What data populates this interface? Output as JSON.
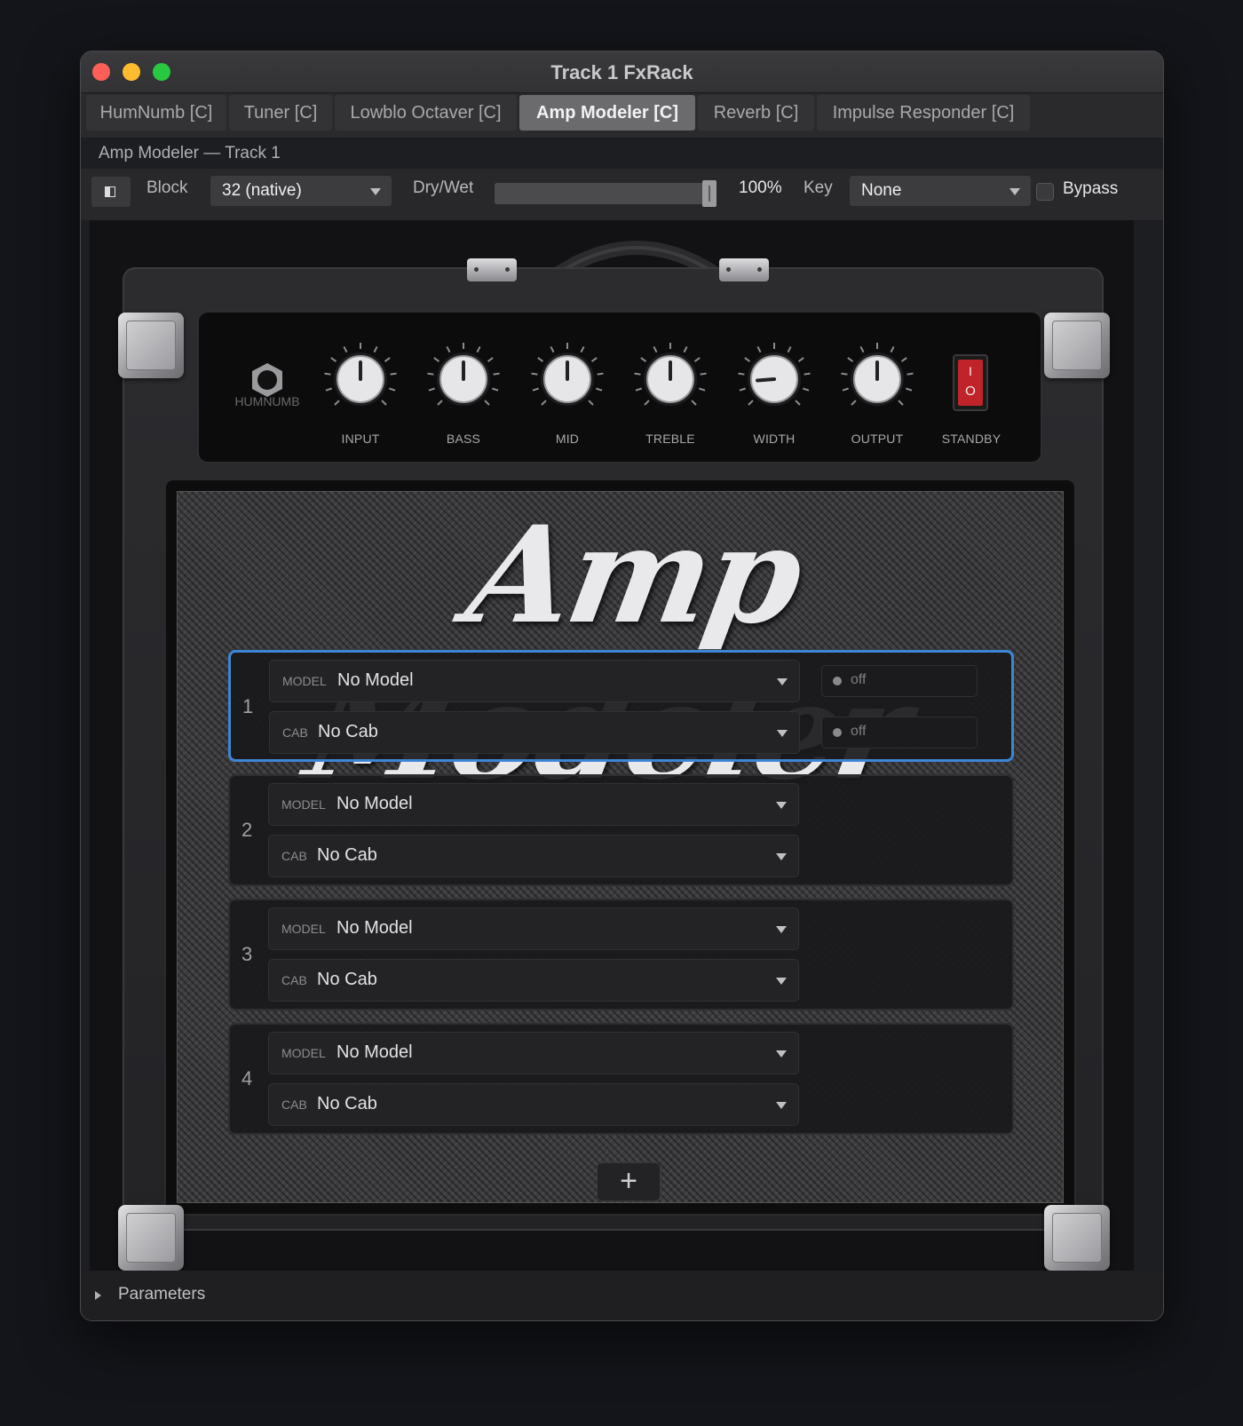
{
  "window": {
    "title": "Track 1 FxRack"
  },
  "tabs": [
    {
      "label": "HumNumb [C]",
      "active": false
    },
    {
      "label": "Tuner [C]",
      "active": false
    },
    {
      "label": "Lowblo Octaver [C]",
      "active": false
    },
    {
      "label": "Amp Modeler [C]",
      "active": true
    },
    {
      "label": "Reverb [C]",
      "active": false
    },
    {
      "label": "Impulse Responder [C]",
      "active": false
    }
  ],
  "subtitle": "Amp Modeler — Track 1",
  "toolbar": {
    "block_label": "Block",
    "block_value": "32 (native)",
    "drywet_label": "Dry/Wet",
    "drywet_value": "100%",
    "drywet_fraction": 0.98,
    "key_label": "Key",
    "key_value": "None",
    "bypass_label": "Bypass",
    "bypass_checked": false
  },
  "amp": {
    "logo": "Amp Modeler",
    "jack_label": "HUMNUMB",
    "knobs": [
      {
        "label": "INPUT",
        "level": 0.5
      },
      {
        "label": "BASS",
        "level": 0.5
      },
      {
        "label": "MID",
        "level": 0.5
      },
      {
        "label": "TREBLE",
        "level": 0.5
      },
      {
        "label": "WIDTH",
        "level": 0.15
      },
      {
        "label": "OUTPUT",
        "level": 0.5
      }
    ],
    "standby_label": "STANDBY",
    "standby_symbols": {
      "top": "I",
      "bottom": "O"
    },
    "slots": [
      {
        "number": "1",
        "model_kind": "MODEL",
        "model": "No Model",
        "cab_kind": "CAB",
        "cab": "No Cab",
        "model_toggle": "off",
        "cab_toggle": "off"
      },
      {
        "number": "2",
        "model_kind": "MODEL",
        "model": "No Model",
        "cab_kind": "CAB",
        "cab": "No Cab"
      },
      {
        "number": "3",
        "model_kind": "MODEL",
        "model": "No Model",
        "cab_kind": "CAB",
        "cab": "No Cab"
      },
      {
        "number": "4",
        "model_kind": "MODEL",
        "model": "No Model",
        "cab_kind": "CAB",
        "cab": "No Cab"
      }
    ],
    "add_symbol": "+"
  },
  "footer": {
    "label": "Parameters"
  },
  "colors": {
    "selection": "#3d86d6",
    "standby_red": "#c0242a"
  }
}
